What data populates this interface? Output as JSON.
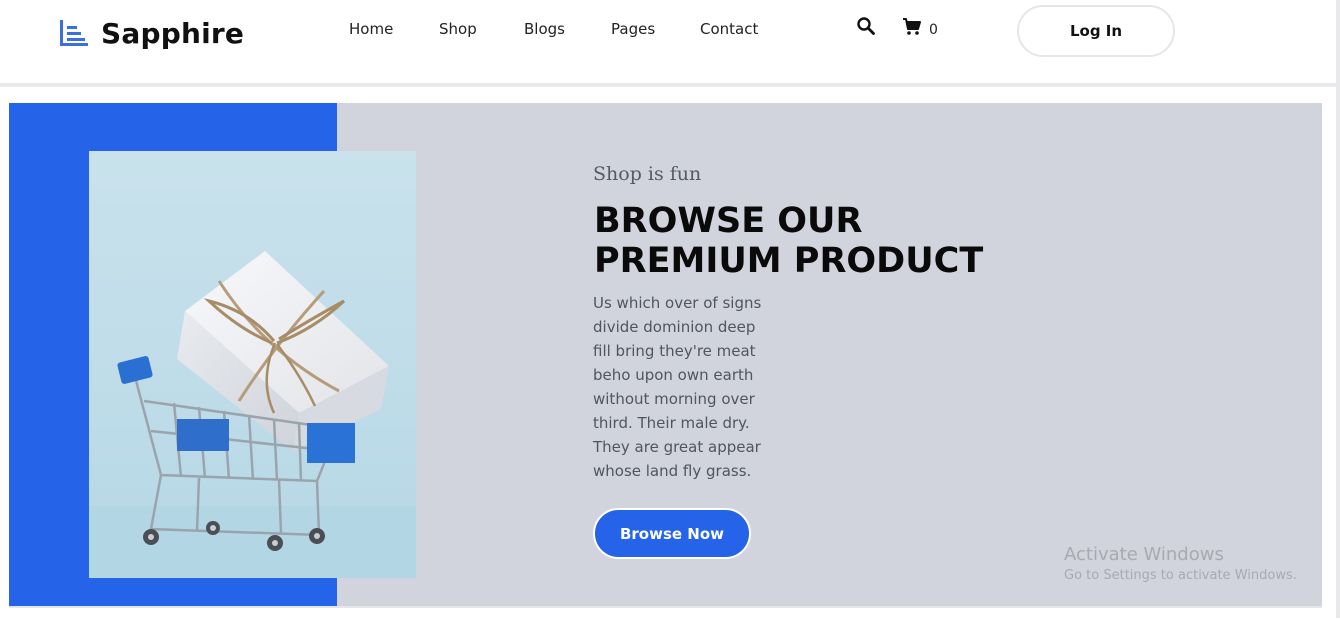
{
  "header": {
    "brand": "Sapphire",
    "logo_icon": "list-lines-icon",
    "nav": [
      {
        "label": "Home"
      },
      {
        "label": "Shop"
      },
      {
        "label": "Blogs"
      },
      {
        "label": "Pages"
      },
      {
        "label": "Contact"
      }
    ],
    "search_icon": "search-icon",
    "cart": {
      "icon": "cart-icon",
      "count": "0"
    },
    "login_label": "Log In"
  },
  "hero": {
    "eyebrow": "Shop is fun",
    "headline": "BROWSE OUR PREMIUM PRODUCT",
    "description": "Us which over of signs divide dominion deep fill bring they're meat beho upon own earth without morning over third. Their male dry. They are great appear whose land fly grass.",
    "button_label": "Browse Now",
    "image_subject": "shopping cart with wrapped gift box"
  },
  "watermark": {
    "title": "Activate Windows",
    "subtitle": "Go to Settings to activate Windows."
  },
  "colors": {
    "accent_blue": "#2563e8",
    "hero_background": "#d1d4dc",
    "image_background": "#c4dfea",
    "text_dark": "#0a0a0a",
    "text_muted": "#4f5561"
  }
}
